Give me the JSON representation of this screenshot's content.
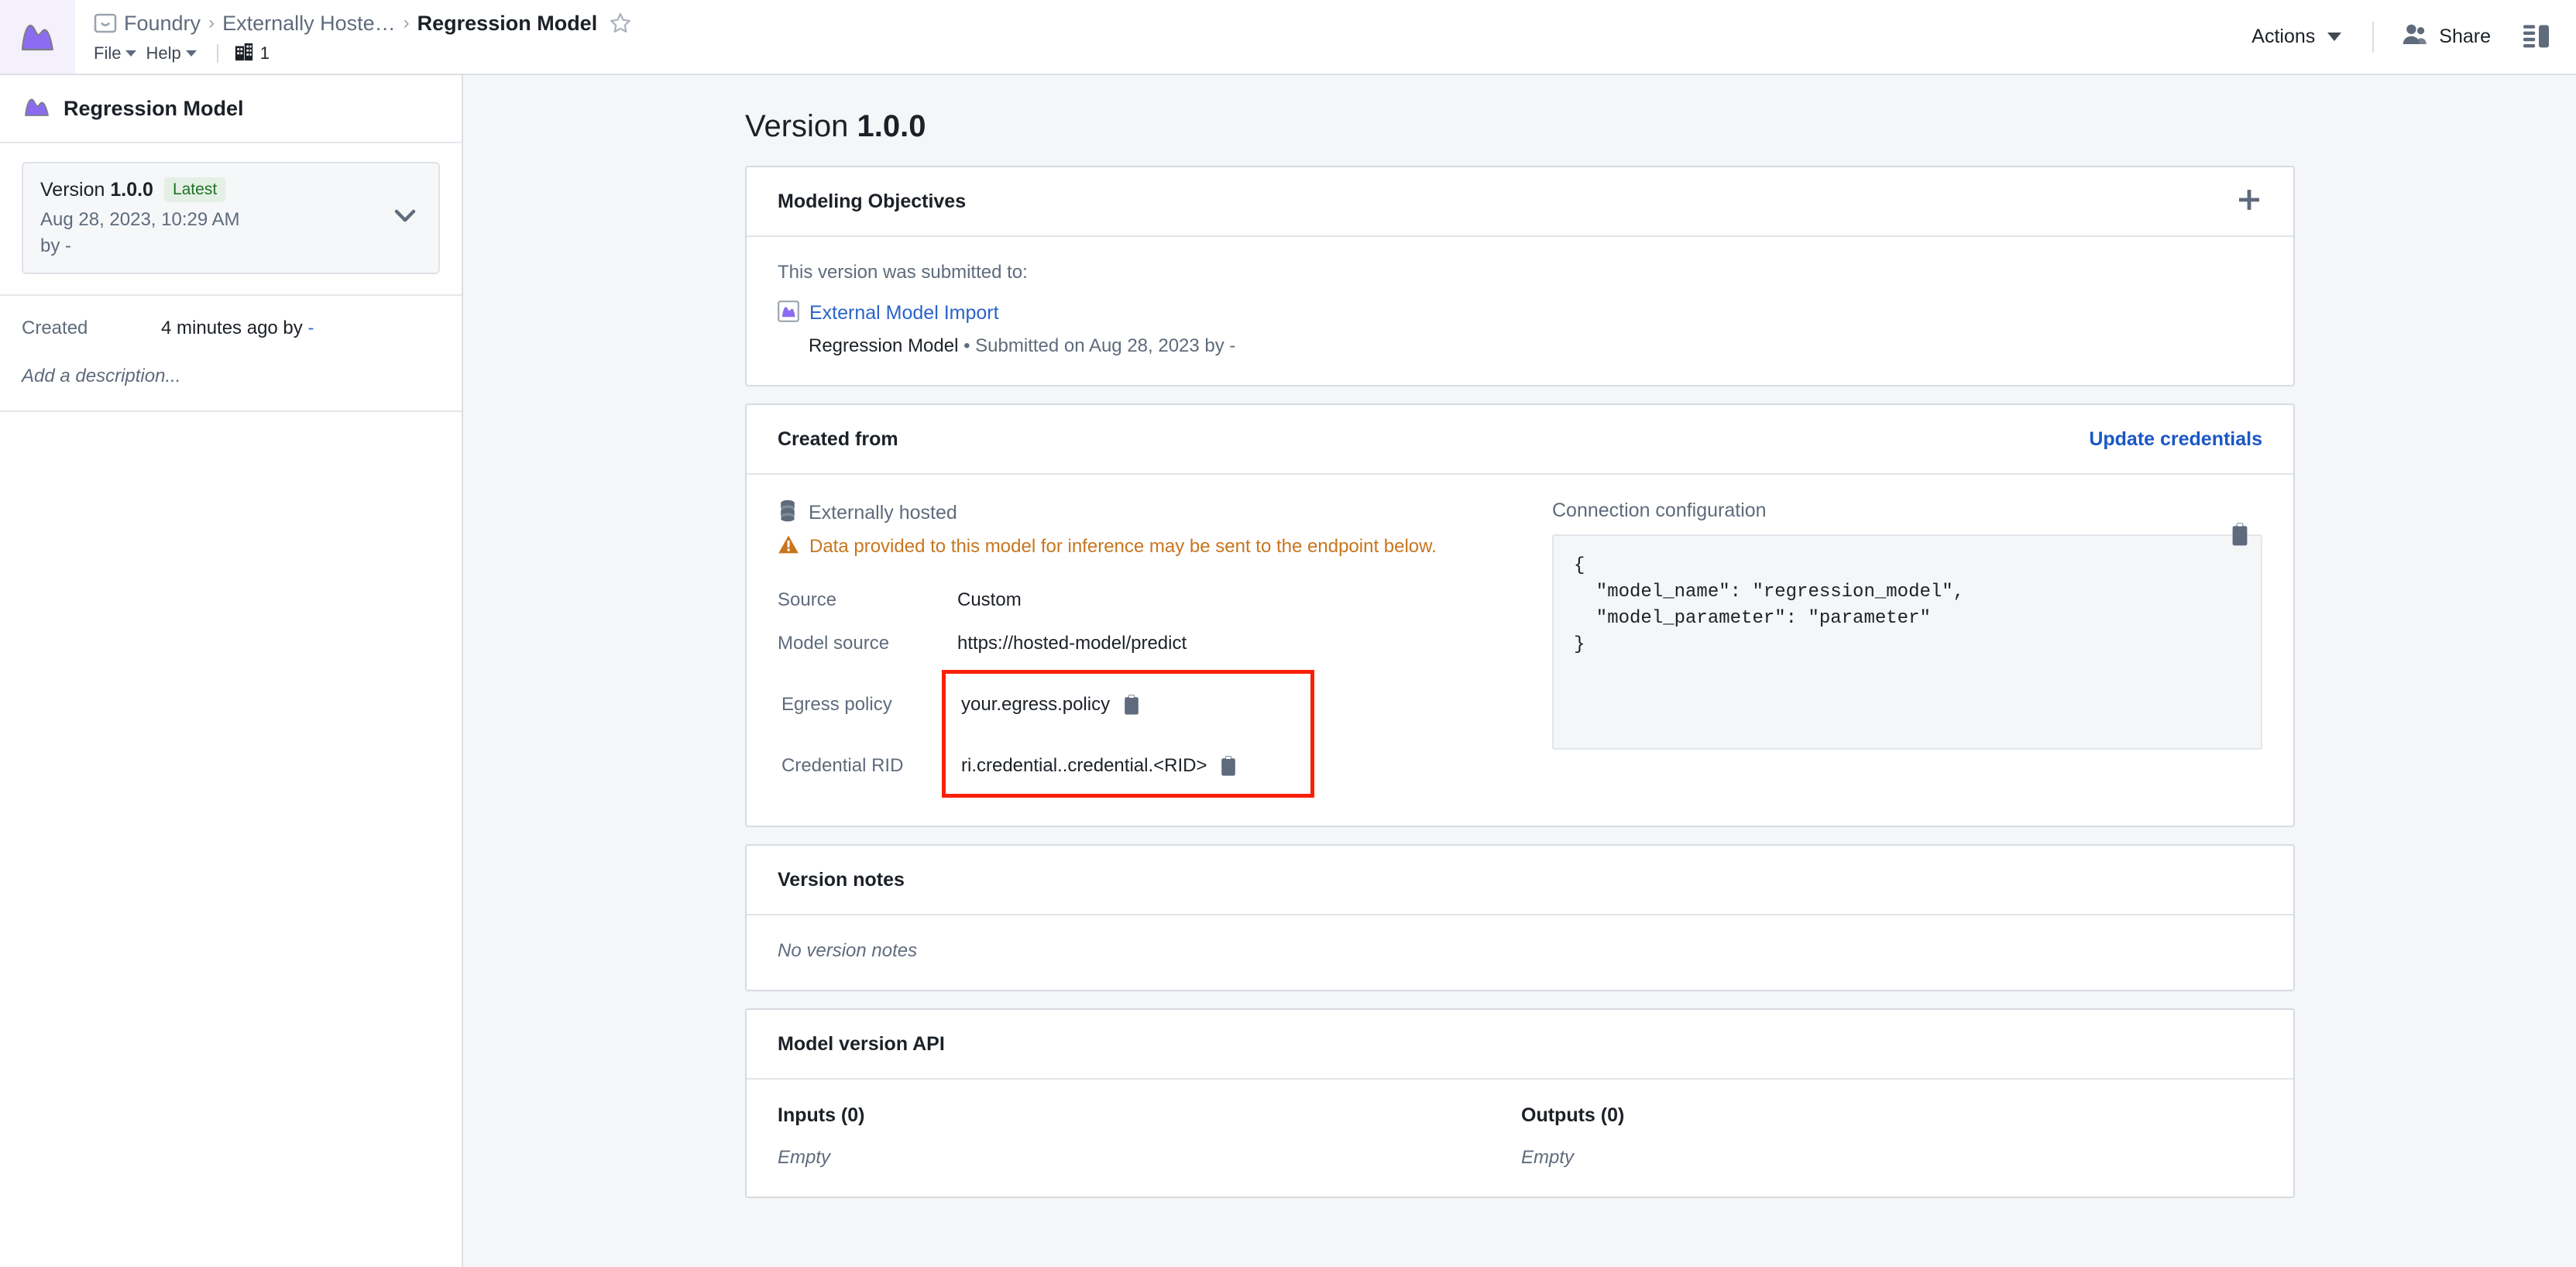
{
  "topbar": {
    "app_logo_icon": "mountain-logo-icon",
    "breadcrumb": {
      "folder_icon": "folder-icon",
      "items": [
        {
          "label": "Foundry"
        },
        {
          "label": "Externally Hoste…"
        }
      ],
      "separator": "›",
      "current": "Regression Model",
      "favorite_icon": "star-icon"
    },
    "menu": [
      {
        "label": "File"
      },
      {
        "label": "Help"
      }
    ],
    "org_badge": {
      "icon": "organization-icon",
      "count": "1"
    },
    "actions_label": "Actions",
    "share_label": "Share",
    "share_icon": "people-icon",
    "panel_toggle_icon": "side-panel-icon"
  },
  "sidebar": {
    "header": {
      "icon": "model-mountain-icon",
      "title": "Regression Model"
    },
    "version_card": {
      "version_prefix": "Version ",
      "version_number": "1.0.0",
      "badge": "Latest",
      "timestamp": "Aug 28, 2023, 10:29 AM",
      "author": "by -",
      "chevron_icon": "chevron-down-icon"
    },
    "meta": {
      "created_label": "Created",
      "created_value": "4 minutes ago by ",
      "created_author": "-",
      "description_placeholder": "Add a description..."
    }
  },
  "main": {
    "page_title_prefix": "Version ",
    "page_title_version": "1.0.0",
    "modeling_objectives": {
      "title": "Modeling Objectives",
      "add_icon": "plus-icon",
      "submitted_to_label": "This version was submitted to:",
      "objective_icon": "model-mountain-icon",
      "objective_link": "External Model Import",
      "objective_sub_name": "Regression Model",
      "objective_sub_meta": " • Submitted on Aug 28, 2023 by -"
    },
    "created_from": {
      "title": "Created from",
      "update_credentials_label": "Update credentials",
      "hosted_icon": "database-icon",
      "hosted_label": "Externally hosted",
      "warning_icon": "warning-triangle-icon",
      "warning_text": "Data provided to this model for inference may be sent to the endpoint below.",
      "rows": [
        {
          "key": "Source",
          "value": "Custom",
          "is_link": false,
          "copyable": false
        },
        {
          "key": "Model source",
          "value": "https://hosted-model/predict",
          "is_link": true,
          "copyable": false
        }
      ],
      "highlighted_rows": [
        {
          "key": "Egress policy",
          "value": "your.egress.policy",
          "copy_icon": "clipboard-icon"
        },
        {
          "key": "Credential RID",
          "value": "ri.credential..credential.<RID>",
          "copy_icon": "clipboard-icon"
        }
      ],
      "highlight_color": "#fa2008",
      "connection": {
        "label": "Connection configuration",
        "copy_icon": "clipboard-icon",
        "code": "{\n  \"model_name\": \"regression_model\",\n  \"model_parameter\": \"parameter\"\n}"
      }
    },
    "version_notes": {
      "title": "Version notes",
      "empty_text": "No version notes"
    },
    "model_version_api": {
      "title": "Model version API",
      "inputs_title": "Inputs (0)",
      "inputs_empty": "Empty",
      "outputs_title": "Outputs (0)",
      "outputs_empty": "Empty"
    }
  },
  "colors": {
    "accent_link": "#2a63c9",
    "brand_purple": "#8b6bf0",
    "warning": "#c7761e",
    "success": "#1d7324",
    "annotation_red": "#fa2008"
  }
}
